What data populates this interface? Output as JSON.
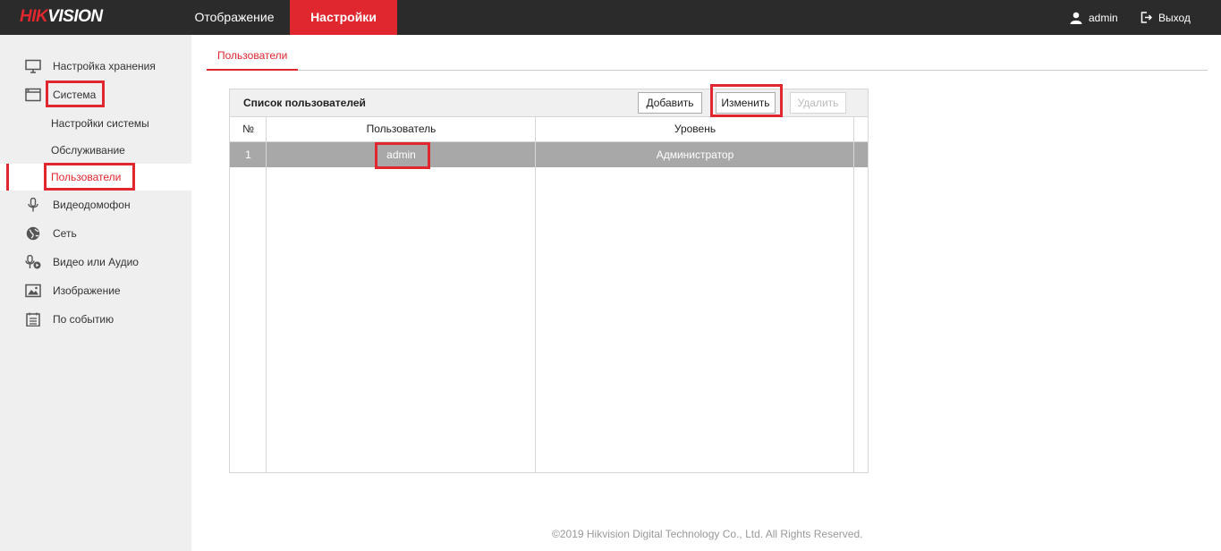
{
  "header": {
    "logo": {
      "part1": "HIK",
      "part2": "VISION"
    },
    "nav": [
      {
        "label": "Отображение",
        "active": false
      },
      {
        "label": "Настройки",
        "active": true
      }
    ],
    "user": "admin",
    "logout": "Выход"
  },
  "sidebar": {
    "items": [
      {
        "label": "Настройка хранения",
        "icon": "monitor-icon"
      },
      {
        "label": "Система",
        "icon": "window-icon"
      },
      {
        "label": "Настройки системы",
        "sub": true
      },
      {
        "label": "Обслуживание",
        "sub": true
      },
      {
        "label": "Пользователи",
        "sub": true,
        "active": true
      },
      {
        "label": "Видеодомофон",
        "icon": "microphone-icon"
      },
      {
        "label": "Сеть",
        "icon": "globe-icon"
      },
      {
        "label": "Видео или Аудио",
        "icon": "mic-play-icon"
      },
      {
        "label": "Изображение",
        "icon": "image-icon"
      },
      {
        "label": "По событию",
        "icon": "calendar-icon"
      }
    ]
  },
  "content": {
    "tab": "Пользователи",
    "panel": {
      "title": "Список пользователей",
      "buttons": {
        "add": "Добавить",
        "edit": "Изменить",
        "delete": "Удалить"
      },
      "columns": [
        "№",
        "Пользователь",
        "Уровень"
      ],
      "rows": [
        {
          "no": "1",
          "user": "admin",
          "level": "Администратор",
          "selected": true
        }
      ]
    }
  },
  "footer": "©2019 Hikvision Digital Technology Co., Ltd. All Rights Reserved.",
  "colors": {
    "accent": "#e0262e",
    "topbar": "#2b2b2b",
    "sidebar": "#efefef",
    "selected_row": "#a8a8a8"
  }
}
